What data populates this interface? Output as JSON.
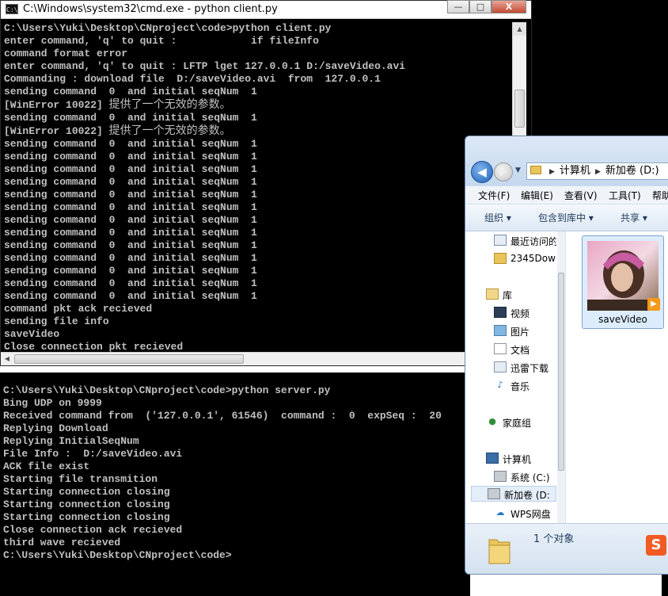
{
  "cmd_window": {
    "title": "C:\\Windows\\system32\\cmd.exe - python  client.py",
    "icon_text": "C:\\",
    "controls": {
      "minimize": "—",
      "maximize": "□",
      "close": "X"
    },
    "client_lines": [
      "C:\\Users\\Yuki\\Desktop\\CNproject\\code>python client.py",
      "enter command, 'q' to quit :            if fileInfo",
      "command format error",
      "enter command, 'q' to quit : LFTP lget 127.0.0.1 D:/saveVideo.avi",
      "Commanding : download file  D:/saveVideo.avi  from  127.0.0.1",
      "sending command  0  and initial seqNum  1",
      "[WinError 10022] 提供了一个无效的参数。",
      "sending command  0  and initial seqNum  1",
      "[WinError 10022] 提供了一个无效的参数。",
      "sending command  0  and initial seqNum  1",
      "sending command  0  and initial seqNum  1",
      "sending command  0  and initial seqNum  1",
      "sending command  0  and initial seqNum  1",
      "sending command  0  and initial seqNum  1",
      "sending command  0  and initial seqNum  1",
      "sending command  0  and initial seqNum  1",
      "sending command  0  and initial seqNum  1",
      "sending command  0  and initial seqNum  1",
      "sending command  0  and initial seqNum  1",
      "sending command  0  and initial seqNum  1",
      "sending command  0  and initial seqNum  1",
      "sending command  0  and initial seqNum  1",
      "command pkt ack recieved",
      "sending file info",
      "saveVideo",
      "Close connection pkt recieved"
    ],
    "scroll_arrows": {
      "up": "▲",
      "down": "▼",
      "left": "◀",
      "thumb_grip": "|||"
    }
  },
  "server_console": {
    "lines": [
      "C:\\Users\\Yuki\\Desktop\\CNproject\\code>python server.py",
      "Bing UDP on 9999",
      "Received command from  ('127.0.0.1', 61546)  command :  0  expSeq :  20",
      "Replying Download",
      "Replying InitialSeqNum",
      "File Info :  D:/saveVideo.avi",
      "ACK file exist",
      "Starting file transmition",
      "Starting connection closing",
      "Starting connection closing",
      "Starting connection closing",
      "Close connection ack recieved",
      "third wave recieved",
      "",
      "C:\\Users\\Yuki\\Desktop\\CNproject\\code>"
    ]
  },
  "explorer": {
    "nav": {
      "back": "◀",
      "forward": "▶",
      "dropdown": "▼"
    },
    "address": {
      "parts": [
        "计算机",
        "新加卷 (D:)"
      ],
      "separator": "▶"
    },
    "menu": [
      "文件(F)",
      "编辑(E)",
      "查看(V)",
      "工具(T)",
      "帮助"
    ],
    "toolbar": [
      "组织 ▾",
      "包含到库中 ▾",
      "共享 ▾"
    ],
    "nav_items": [
      {
        "label": "最近访问的",
        "icon": "recent-places-icon"
      },
      {
        "label": "2345Dow",
        "icon": "folder-icon"
      },
      {
        "label": "库",
        "icon": "library-icon"
      },
      {
        "label": "视频",
        "icon": "video-library-icon"
      },
      {
        "label": "图片",
        "icon": "pictures-library-icon"
      },
      {
        "label": "文档",
        "icon": "documents-library-icon"
      },
      {
        "label": "迅雷下载",
        "icon": "thunder-download-icon"
      },
      {
        "label": "音乐",
        "icon": "music-library-icon"
      },
      {
        "label": "家庭组",
        "icon": "homegroup-icon"
      },
      {
        "label": "计算机",
        "icon": "computer-icon"
      },
      {
        "label": "系统 (C:)",
        "icon": "drive-c-icon"
      },
      {
        "label": "新加卷 (D:",
        "icon": "drive-d-icon"
      },
      {
        "label": "WPS网盘",
        "icon": "cloud-drive-icon"
      }
    ],
    "file": {
      "name": "saveVideo",
      "type_icon": "video-play-icon"
    },
    "details": {
      "count": "1 个对象"
    },
    "sogou": "S"
  }
}
